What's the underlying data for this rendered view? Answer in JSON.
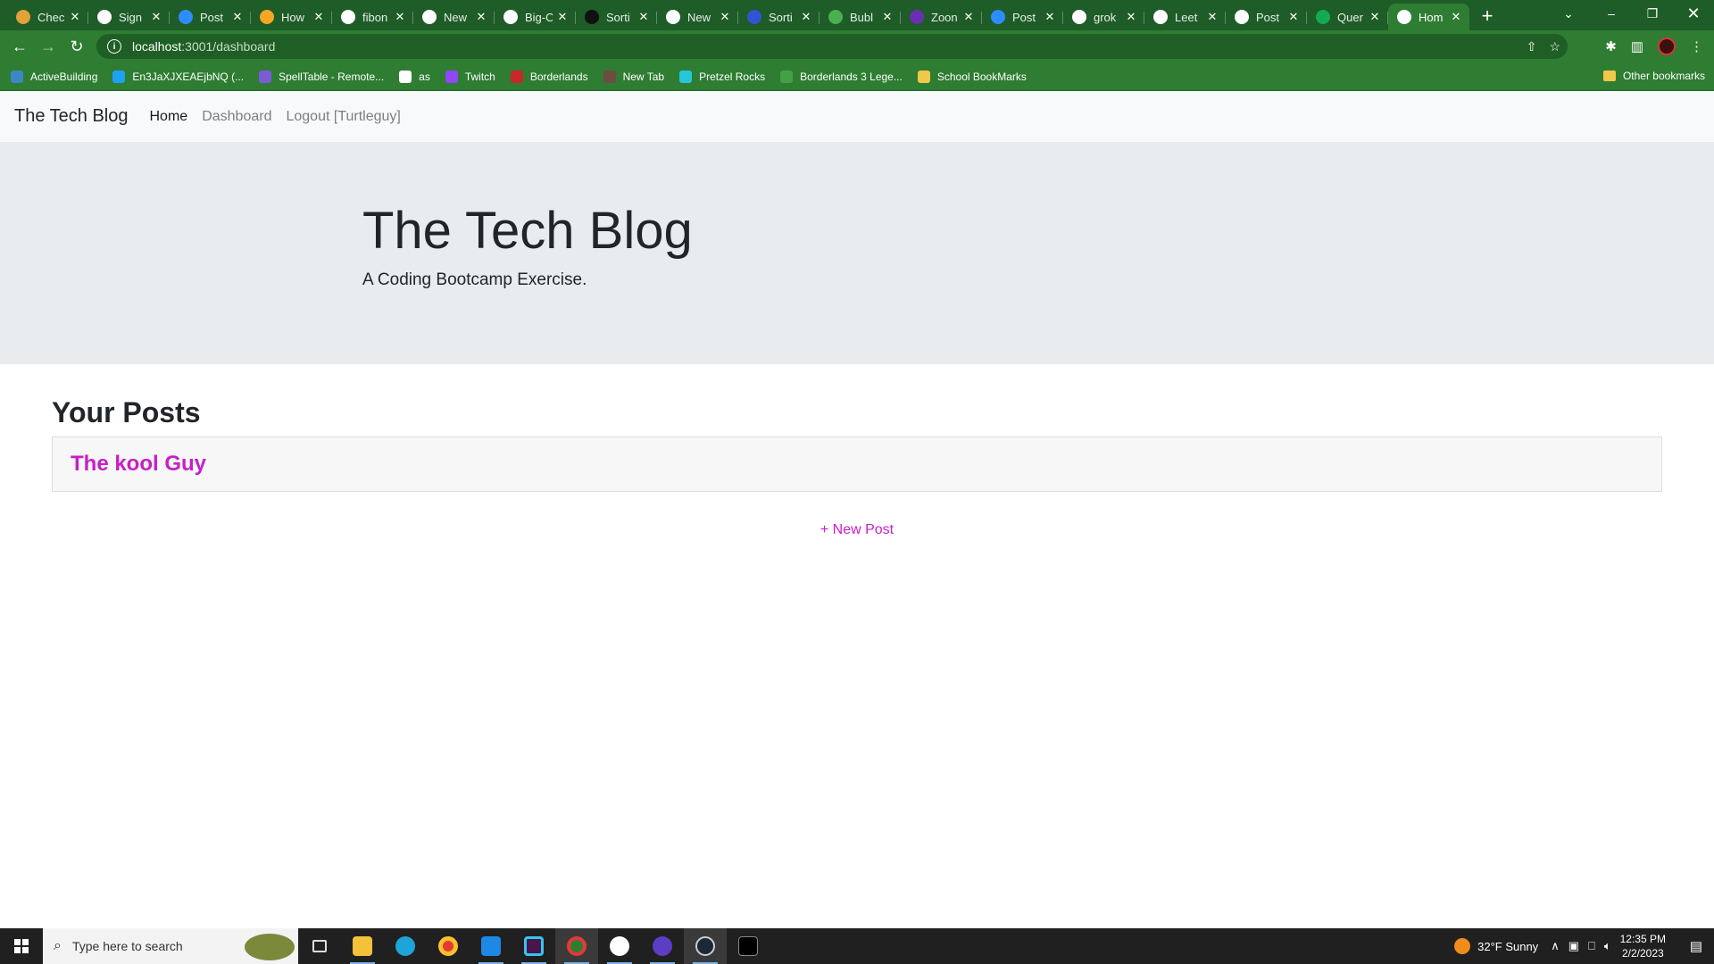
{
  "browser": {
    "tabs": [
      {
        "title": "Chec",
        "icon": "tab-favicon-cookie-icon",
        "color": "#e2a13a"
      },
      {
        "title": "Sign",
        "icon": "tab-favicon-github-icon",
        "color": "#ffffff"
      },
      {
        "title": "Post",
        "icon": "tab-favicon-zoom-icon",
        "color": "#2d8cff"
      },
      {
        "title": "How",
        "icon": "tab-favicon-hs-icon",
        "color": "#f5a623"
      },
      {
        "title": "fibon",
        "icon": "tab-favicon-google-icon",
        "color": "#ffffff"
      },
      {
        "title": "New",
        "icon": "tab-favicon-github-icon",
        "color": "#ffffff"
      },
      {
        "title": "Big-O",
        "icon": "tab-favicon-github-icon",
        "color": "#ffffff"
      },
      {
        "title": "Sorti",
        "icon": "tab-favicon-va-icon",
        "color": "#111111"
      },
      {
        "title": "New",
        "icon": "tab-favicon-github-icon",
        "color": "#ffffff"
      },
      {
        "title": "Sorti",
        "icon": "tab-favicon-bluetooth-icon",
        "color": "#2f55d4"
      },
      {
        "title": "Bubl",
        "icon": "tab-favicon-infinity-icon",
        "color": "#4caf50"
      },
      {
        "title": "Zoon",
        "icon": "tab-favicon-n-icon",
        "color": "#6b2fb3"
      },
      {
        "title": "Post",
        "icon": "tab-favicon-zoom-icon",
        "color": "#2d8cff"
      },
      {
        "title": "grok",
        "icon": "tab-favicon-google-icon",
        "color": "#ffffff"
      },
      {
        "title": "Leet",
        "icon": "tab-favicon-google-icon",
        "color": "#ffffff"
      },
      {
        "title": "Post",
        "icon": "tab-favicon-google-icon",
        "color": "#ffffff"
      },
      {
        "title": "Quer",
        "icon": "tab-favicon-mongodb-icon",
        "color": "#13aa52"
      },
      {
        "title": "Hom",
        "icon": "tab-favicon-github-icon",
        "color": "#ffffff",
        "active": true
      }
    ],
    "url_host": "localhost",
    "url_path": ":3001/dashboard",
    "bookmarks": [
      {
        "label": "ActiveBuilding",
        "color": "#3b87c4"
      },
      {
        "label": "En3JaXJXEAEjbNQ (...",
        "color": "#1da1f2"
      },
      {
        "label": "SpellTable - Remote...",
        "color": "#7b5cd6"
      },
      {
        "label": "as",
        "color": "#ffffff"
      },
      {
        "label": "Twitch",
        "color": "#9146ff"
      },
      {
        "label": "Borderlands",
        "color": "#c62828"
      },
      {
        "label": "New Tab",
        "color": "#6d4c41"
      },
      {
        "label": "Pretzel Rocks",
        "color": "#26c6da"
      },
      {
        "label": "Borderlands 3 Lege...",
        "color": "#43a047"
      },
      {
        "label": "School BookMarks",
        "color": "#f3c74a"
      }
    ],
    "other_bookmarks": "Other bookmarks"
  },
  "site": {
    "brand": "The Tech Blog",
    "nav": {
      "home": "Home",
      "dashboard": "Dashboard",
      "logout": "Logout [Turtleguy]"
    },
    "hero_title": "The Tech Blog",
    "hero_subtitle": "A Coding Bootcamp Exercise.",
    "posts_heading": "Your Posts",
    "posts": [
      {
        "title": "The kool Guy"
      }
    ],
    "new_post": "+ New Post",
    "accent": "#c71fc7"
  },
  "taskbar": {
    "search_placeholder": "Type here to search",
    "weather": "32°F  Sunny",
    "time": "12:35 PM",
    "date": "2/2/2023"
  }
}
